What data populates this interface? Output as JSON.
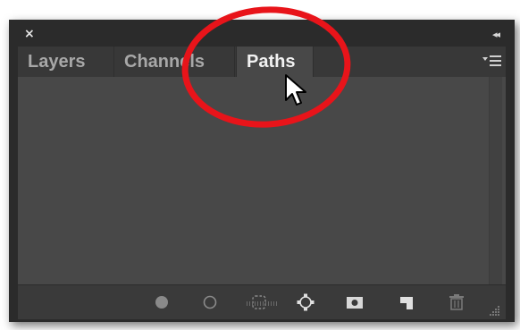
{
  "panel": {
    "close_glyph": "×",
    "collapse_glyph": "◂◂",
    "tabs": [
      {
        "label": "Layers",
        "active": false
      },
      {
        "label": "Channels",
        "active": false
      },
      {
        "label": "Paths",
        "active": true
      }
    ],
    "menu_icon": "panel-menu-icon",
    "footer_icons": [
      "fill-path-icon",
      "stroke-path-icon",
      "load-path-as-selection-icon",
      "make-work-path-icon",
      "add-mask-icon",
      "create-new-path-icon",
      "delete-path-icon"
    ]
  },
  "colors": {
    "frame": "#2b2b2b",
    "tabbar": "#383838",
    "active_tab": "#484848",
    "content": "#484848",
    "highlight_ring": "#e8141a"
  }
}
